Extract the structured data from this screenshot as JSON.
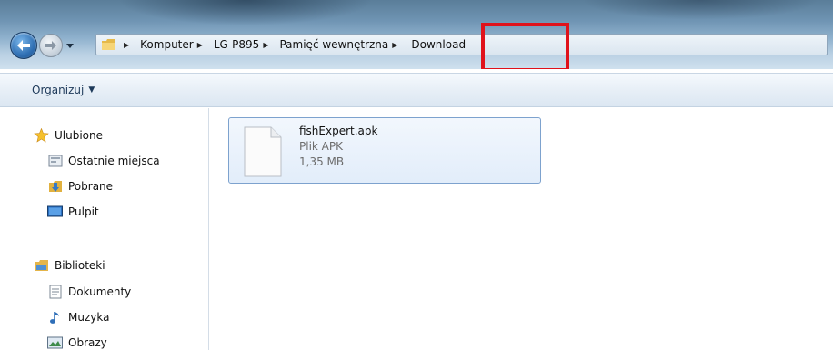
{
  "address_bar": {
    "crumbs": [
      "Komputer",
      "LG-P895",
      "Pamięć wewnętrzna"
    ],
    "current": "Download"
  },
  "toolbar": {
    "organize_label": "Organizuj"
  },
  "sidebar": {
    "favorites": {
      "label": "Ulubione",
      "items": [
        "Ostatnie miejsca",
        "Pobrane",
        "Pulpit"
      ]
    },
    "libraries": {
      "label": "Biblioteki",
      "items": [
        "Dokumenty",
        "Muzyka",
        "Obrazy"
      ]
    }
  },
  "files": [
    {
      "name": "fishExpert.apk",
      "type": "Plik APK",
      "size": "1,35 MB"
    }
  ],
  "colors": {
    "highlight": "#e0121b",
    "selection_border": "#7da2ce"
  },
  "icons": {
    "back": "back-arrow-icon",
    "forward": "forward-arrow-icon",
    "folder": "folder-icon",
    "star": "star-icon",
    "recent": "recent-places-icon",
    "downloads": "downloads-icon",
    "desktop": "desktop-icon",
    "library": "library-icon",
    "documents": "documents-icon",
    "music": "music-icon",
    "pictures": "pictures-icon",
    "file": "file-icon"
  }
}
